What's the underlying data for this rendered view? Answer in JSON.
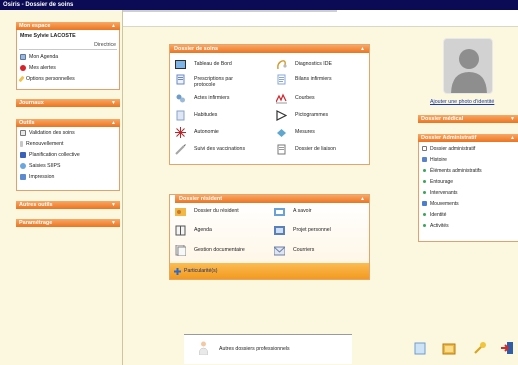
{
  "window": {
    "title": "Osiris - Dossier de soins"
  },
  "sidebar": {
    "mon_espace": {
      "header": "Mon espace",
      "user_name": "Mme Sylvie LACOSTE",
      "role": "Directrice",
      "items": [
        {
          "label": "Mon Agenda",
          "icon": "calendar-icon"
        },
        {
          "label": "Mes alertes",
          "icon": "alert-icon"
        },
        {
          "label": "Options personnelles",
          "icon": "pencil-icon"
        }
      ]
    },
    "journaux": {
      "header": "Journaux"
    },
    "outils": {
      "header": "Outils",
      "items": [
        {
          "label": "Validation des soins",
          "icon": "checklist-icon"
        },
        {
          "label": "Renouvellement",
          "icon": "syringe-icon"
        },
        {
          "label": "Planification collective",
          "icon": "grid-icon"
        },
        {
          "label": "Saisies SIIPS",
          "icon": "globe-icon"
        },
        {
          "label": "Impression",
          "icon": "printer-icon"
        }
      ]
    },
    "autres_outils": {
      "header": "Autres outils"
    },
    "parametrage": {
      "header": "Paramétrage"
    }
  },
  "dossier_soins": {
    "header": "Dossier de soins",
    "items": [
      {
        "label": "Tableau de Bord",
        "icon": "dashboard-icon"
      },
      {
        "label": "Diagnostics IDE",
        "icon": "stethoscope-icon"
      },
      {
        "label": "Prescriptions par protocole",
        "icon": "prescription-icon"
      },
      {
        "label": "Bilans infirmiers",
        "icon": "document-icon"
      },
      {
        "label": "Actes infirmiers",
        "icon": "nurse-icon"
      },
      {
        "label": "Courbes",
        "icon": "curve-icon"
      },
      {
        "label": "Habitudes",
        "icon": "habits-icon"
      },
      {
        "label": "Pictogrammes",
        "icon": "pictogram-icon"
      },
      {
        "label": "Autonomie",
        "icon": "autonomy-icon"
      },
      {
        "label": "Mesures",
        "icon": "measure-icon"
      },
      {
        "label": "Suivi des vaccinations",
        "icon": "vaccine-icon"
      },
      {
        "label": "Dossier de liaison",
        "icon": "folder-link-icon"
      }
    ]
  },
  "dossier_resident": {
    "header": "Dossier résident",
    "items": [
      {
        "label": "Dossier du résident",
        "icon": "resident-folder-icon"
      },
      {
        "label": "A savoir",
        "icon": "info-icon"
      },
      {
        "label": "Agenda",
        "icon": "agenda-icon"
      },
      {
        "label": "Projet personnel",
        "icon": "project-icon"
      },
      {
        "label": "Gestion documentaire",
        "icon": "docs-icon"
      },
      {
        "label": "Courriers",
        "icon": "mail-icon"
      }
    ],
    "particularites": "Particularité(s)"
  },
  "autres_dossiers": {
    "label": "Autres dossiers professionnels"
  },
  "right": {
    "photo_link": "Ajouter une photo d'identité",
    "dossier_medical": {
      "header": "Dossier médical"
    },
    "dossier_administratif": {
      "header": "Dossier Administratif",
      "items": [
        {
          "label": "Dossier administratif"
        },
        {
          "label": "Histoire"
        },
        {
          "label": "Éléments administratifs"
        },
        {
          "label": "Entourage"
        },
        {
          "label": "Intervenants"
        },
        {
          "label": "Mouvements"
        },
        {
          "label": "Identité"
        },
        {
          "label": "Activités"
        }
      ]
    }
  },
  "colors": {
    "accent": "#ec7420",
    "title_bar": "#0b0b55",
    "background": "#fbf8df",
    "link": "#1a3aa5"
  }
}
